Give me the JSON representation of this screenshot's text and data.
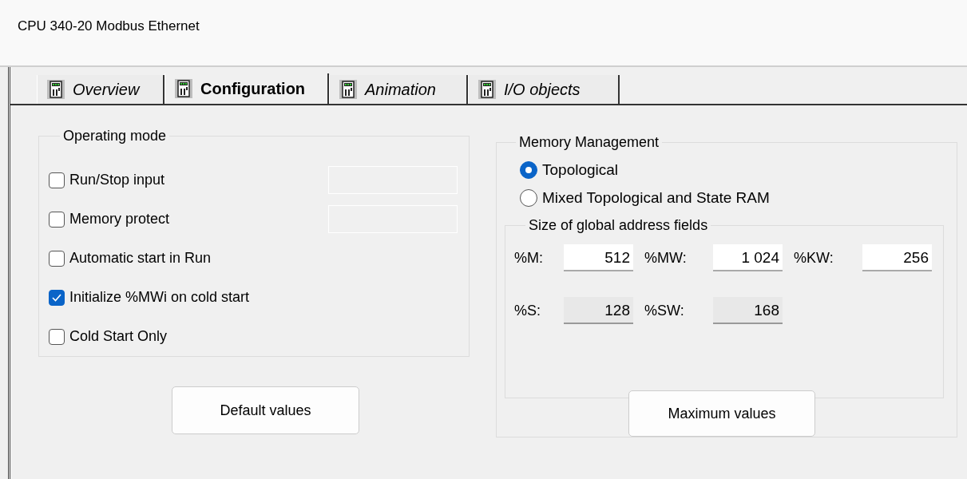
{
  "window": {
    "title": "CPU 340-20 Modbus Ethernet"
  },
  "tabs": [
    {
      "label": "Overview",
      "selected": false
    },
    {
      "label": "Configuration",
      "selected": true
    },
    {
      "label": "Animation",
      "selected": false
    },
    {
      "label": "I/O objects",
      "selected": false
    }
  ],
  "operating_mode": {
    "title": "Operating mode",
    "items": [
      {
        "kind": "with_field",
        "label": "Run/Stop input",
        "checked": false,
        "field_disabled": true
      },
      {
        "kind": "with_field",
        "label": "Memory protect",
        "checked": false,
        "field_disabled": true
      },
      {
        "kind": "plain",
        "label": "Automatic start in Run",
        "checked": false
      },
      {
        "kind": "plain",
        "label": "Initialize %MWi on cold start",
        "checked": true
      },
      {
        "kind": "plain",
        "label": "Cold Start Only",
        "checked": false
      }
    ],
    "button": "Default values"
  },
  "memory_management": {
    "title": "Memory Management",
    "options": [
      {
        "label": "Topological",
        "selected": true
      },
      {
        "label": "Mixed Topological and State RAM",
        "selected": false
      }
    ],
    "address_fields": {
      "title": "Size of global address fields",
      "rows": [
        [
          {
            "label": "%M:",
            "value": "512",
            "disabled": false
          },
          {
            "label": "%MW:",
            "value": "1 024",
            "disabled": false
          },
          {
            "label": "%KW:",
            "value": "256",
            "disabled": false
          }
        ],
        [
          {
            "label": "%S:",
            "value": "128",
            "disabled": true
          },
          {
            "label": "%SW:",
            "value": "168",
            "disabled": true
          }
        ]
      ]
    },
    "button": "Maximum values"
  }
}
